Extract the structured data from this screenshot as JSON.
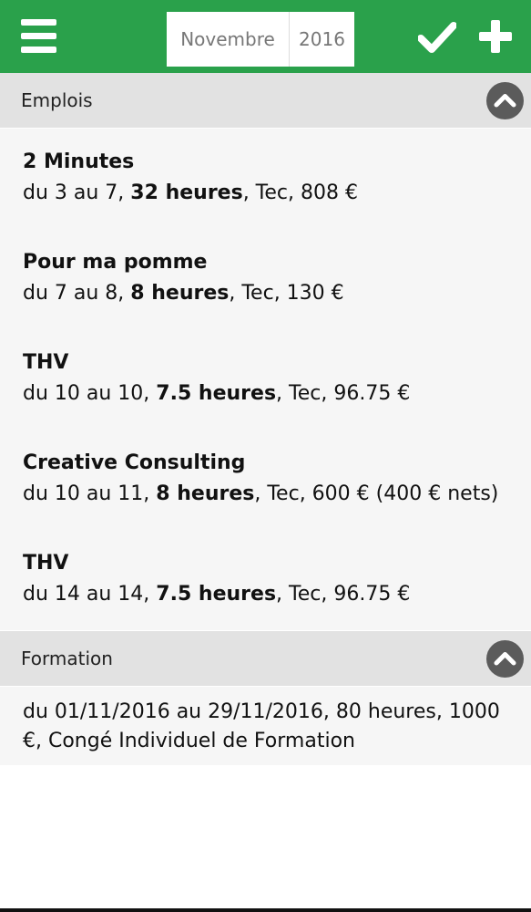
{
  "header": {
    "month": "Novembre",
    "year": "2016",
    "colors": {
      "bar": "#2aa14b",
      "icon": "#ffffff"
    },
    "icons": [
      "menu-icon",
      "check-icon",
      "plus-icon"
    ]
  },
  "sections": {
    "emplois": {
      "title": "Emplois"
    },
    "formation": {
      "title": "Formation"
    }
  },
  "jobs": [
    {
      "name": "2 Minutes",
      "period": "du 3 au 7, ",
      "hours": "32 heures",
      "rest": ", Tec, 808 €"
    },
    {
      "name": "Pour ma pomme",
      "period": "du 7 au 8, ",
      "hours": "8 heures",
      "rest": ", Tec, 130 €"
    },
    {
      "name": "THV",
      "period": "du 10 au 10, ",
      "hours": "7.5 heures",
      "rest": ", Tec, 96.75 €"
    },
    {
      "name": "Creative Consulting",
      "period": "du 10 au 11, ",
      "hours": "8 heures",
      "rest": ", Tec, 600 € (400 € nets)"
    },
    {
      "name": "THV",
      "period": "du 14 au 14, ",
      "hours": "7.5 heures",
      "rest": ", Tec, 96.75 €"
    }
  ],
  "formation": {
    "text": "du 01/11/2016 au 29/11/2016, 80 heures, 1000 €, Congé Individuel de Formation"
  }
}
